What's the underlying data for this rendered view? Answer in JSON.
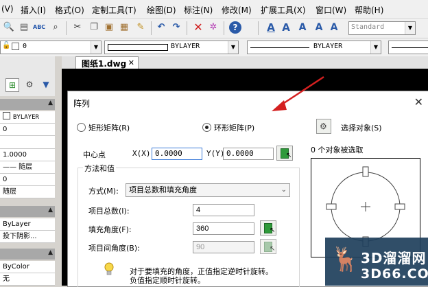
{
  "menu": [
    "(V)",
    "插入(I)",
    "格式(O)",
    "定制工具(T)",
    "绘图(D)",
    "标注(N)",
    "修改(M)",
    "扩展工具(X)",
    "窗口(W)",
    "帮助(H)"
  ],
  "toolbar": {
    "text_style": "Standard",
    "layer_value": "0",
    "color_value": "BYLAYER",
    "linetype_value": "BYLAYER"
  },
  "left_panel": {
    "rows_a": [
      "BYLAYER",
      "0",
      "",
      "1.0000",
      "—— 随层",
      "0",
      "随层"
    ],
    "rows_b": [
      "ByLayer",
      "投下阴影..."
    ],
    "rows_c": [
      "ByColor",
      "无"
    ]
  },
  "tab": {
    "label": "图纸1.dwg",
    "close": "✕"
  },
  "dialog": {
    "title": "阵列",
    "close": "✕",
    "radio_rect": "矩形矩阵(R)",
    "radio_polar": "环形矩阵(P)",
    "select_objects": "选择对象(S)",
    "selected_status": "0 个对象被选取",
    "center_label": "中心点",
    "x_label": "X(X)",
    "x_value": "0.0000",
    "y_label": "Y(Y)",
    "y_value": "0.0000",
    "method_group": "方法和值",
    "method_label": "方式(M):",
    "method_value": "项目总数和填充角度",
    "total_label": "项目总数(I):",
    "total_value": "4",
    "fill_label": "填充角度(F):",
    "fill_value": "360",
    "between_label": "项目间角度(B):",
    "between_value": "90",
    "hint_line1": "对于要填充的角度，正值指定逆时针旋转。",
    "hint_line2": "负值指定顺时针旋转。"
  },
  "watermark": {
    "name": "3D溜溜网",
    "url": "3D66.COM"
  },
  "colors": {
    "arrow": "#d42020",
    "canvas": "#000000",
    "dialog_bg": "#ffffff",
    "watermark_bg": "#1f3f5c"
  }
}
